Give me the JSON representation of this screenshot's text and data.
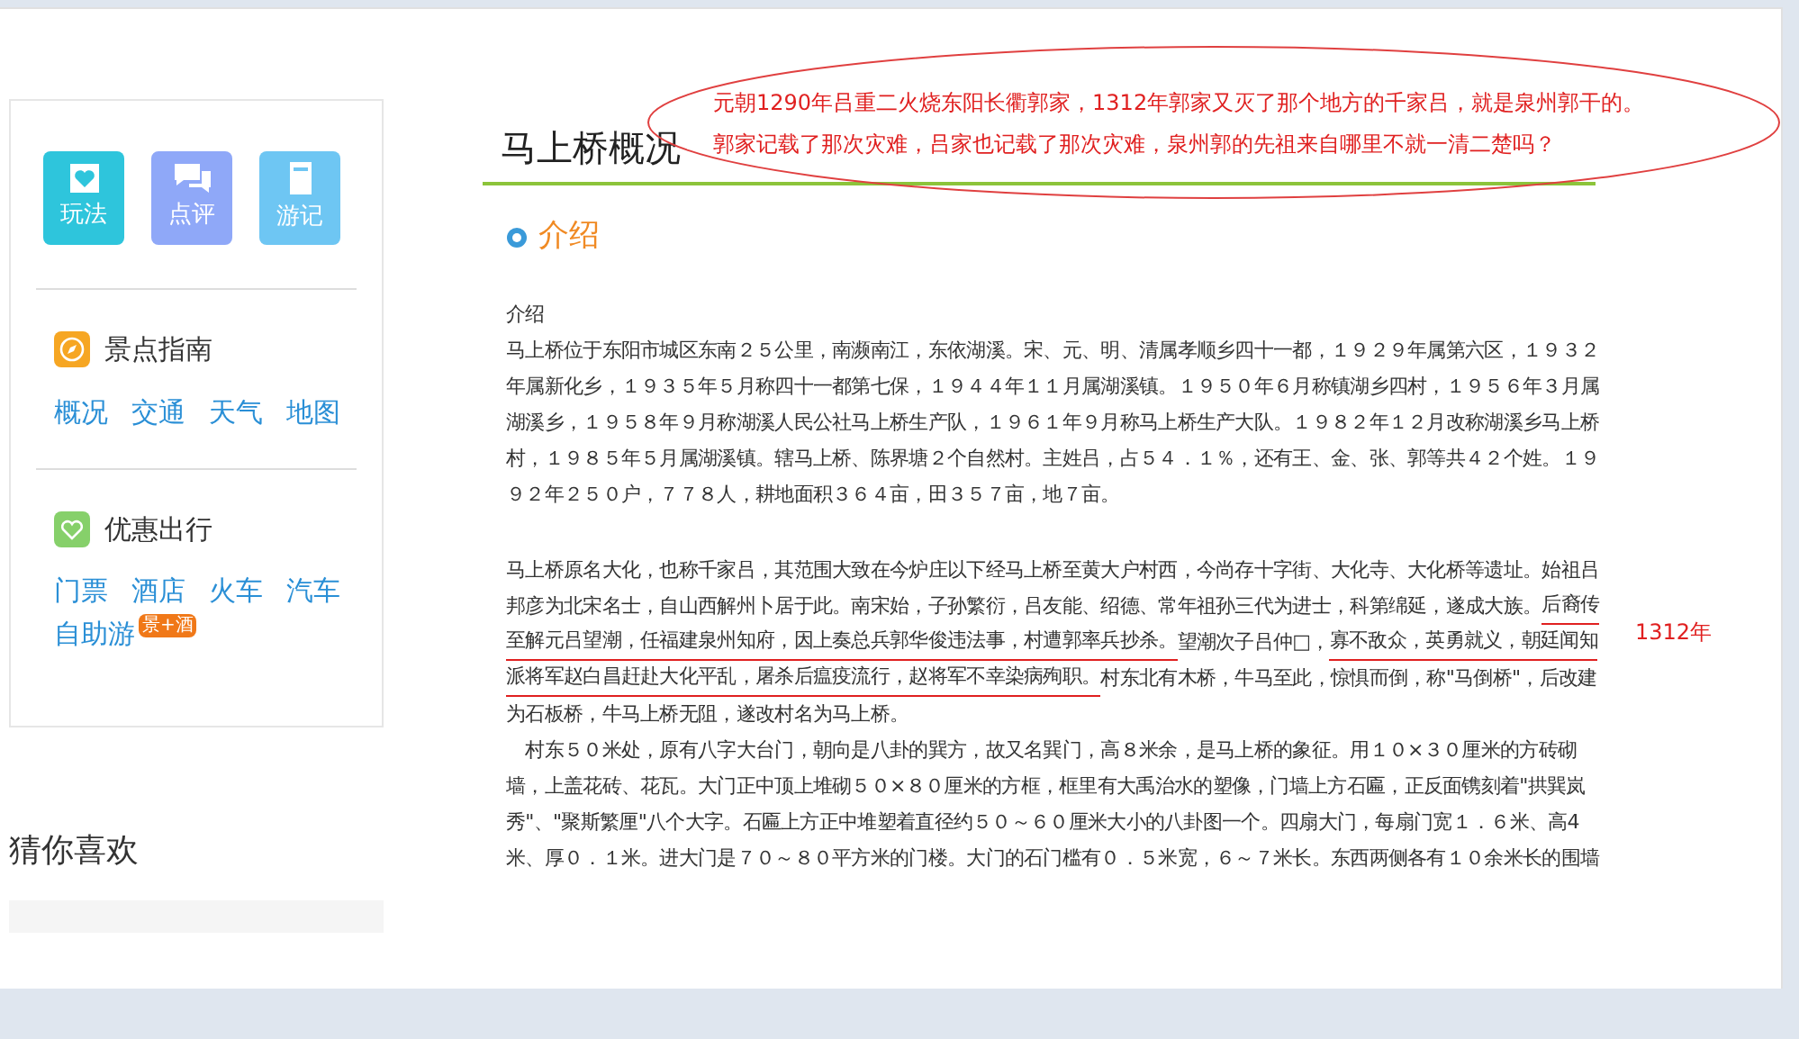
{
  "sidebar": {
    "quick_links": [
      {
        "label": "玩法",
        "kind": "guide"
      },
      {
        "label": "点评",
        "kind": "review"
      },
      {
        "label": "游记",
        "kind": "notes"
      }
    ],
    "sections": [
      {
        "title": "景点指南",
        "kind": "compass",
        "links": [
          {
            "label": "概况"
          },
          {
            "label": "交通"
          },
          {
            "label": "天气"
          },
          {
            "label": "地图"
          }
        ]
      },
      {
        "title": "优惠出行",
        "kind": "heart",
        "links": [
          {
            "label": "门票"
          },
          {
            "label": "酒店"
          },
          {
            "label": "火车"
          },
          {
            "label": "汽车"
          },
          {
            "label": "自助游",
            "badge": "景+酒"
          }
        ]
      }
    ],
    "recommend_title": "猜你喜欢"
  },
  "article": {
    "title": "马上桥概况",
    "section_heading": "介绍",
    "subheading": "介绍",
    "paragraphs": [
      {
        "lines": [
          "马上桥位于东阳市城区东南２５公里，南濒南江，东依湖溪。宋、元、明、清属孝顺乡四十一都，１９２９年属第六区，１９３２",
          "年属新化乡，１９３５年５月称四十一都第七保，１９４４年１１月属湖溪镇。１９５０年６月称镇湖乡四村，１９５６年３月属",
          "湖溪乡，１９５８年９月称湖溪人民公社马上桥生产队，１９６１年９月称马上桥生产大队。１９８２年１２月改称湖溪乡马上桥",
          "村，１９８５年５月属湖溪镇。辖马上桥、陈界塘２个自然村。主姓吕，占５４．１％，还有王、金、张、郭等共４２个姓。１９",
          "９２年２５０户，７７８人，耕地面积３６４亩，田３５７亩，地７亩。"
        ]
      },
      {
        "lines": [
          [
            {
              "text": "马上桥原名大化，也称千家吕，其范围大致在今炉庄以下经马上桥至黄大户村西，今尚存十字街、大化寺、大化桥等遗址。始祖吕",
              "underlined": false
            }
          ],
          [
            {
              "text": "邦彦为北宋名士，自山西解州卜居于此。南宋始，子孙繁衍，吕友能、绍德、常年祖孙三代为进士，科第绵延，遂成大族。",
              "underlined": false
            },
            {
              "text": "后裔传",
              "underlined": true
            }
          ],
          [
            {
              "text": "至解元吕望潮，任福建泉州知府，因上奏总兵郭华俊违法事，村遭郭率兵抄杀。",
              "underlined": true
            },
            {
              "text": "望潮次子吕仲□，",
              "underlined": false
            },
            {
              "text": "寡不敌众，英勇就义，朝廷闻知",
              "underlined": true
            }
          ],
          [
            {
              "text": "派将军赵白昌赶赴大化平乱，屠杀后瘟疫流行，赵将军不幸染病殉职。",
              "underlined": true
            },
            {
              "text": "村东北有木桥，牛马至此，惊惧而倒，称\"马倒桥\"，后改建",
              "underlined": false
            }
          ],
          [
            {
              "text": "为石板桥，牛马上桥无阻，遂改村名为马上桥。",
              "underlined": false
            }
          ]
        ]
      },
      {
        "lines": [
          "　村东５０米处，原有八字大台门，朝向是八卦的巽方，故又名巽门，高８米余，是马上桥的象征。用１０×３０厘米的方砖砌",
          "墙，上盖花砖、花瓦。大门正中顶上堆砌５０×８０厘米的方框，框里有大禹治水的塑像，门墙上方石匾，正反面镌刻着\"拱巽岚",
          "秀\"、\"聚斯繁厘\"八个大字。石匾上方正中堆塑着直径约５０～６０厘米大小的八卦图一个。四扇大门，每扇门宽１．６米、高4",
          "米、厚０．１米。进大门是７０～８０平方米的门楼。大门的石门槛有０．５米宽，６～７米长。东西两侧各有１０余米长的围墙"
        ]
      }
    ],
    "annotation": [
      "元朝1290年吕重二火烧东阳长衢郭家，1312年郭家又灭了那个地方的千家吕，就是泉州郭干的。",
      "郭家记载了那次灾难，吕家也记载了那次灾难，泉州郭的先祖来自哪里不就一清二楚吗？"
    ],
    "margin_note": "1312年"
  }
}
